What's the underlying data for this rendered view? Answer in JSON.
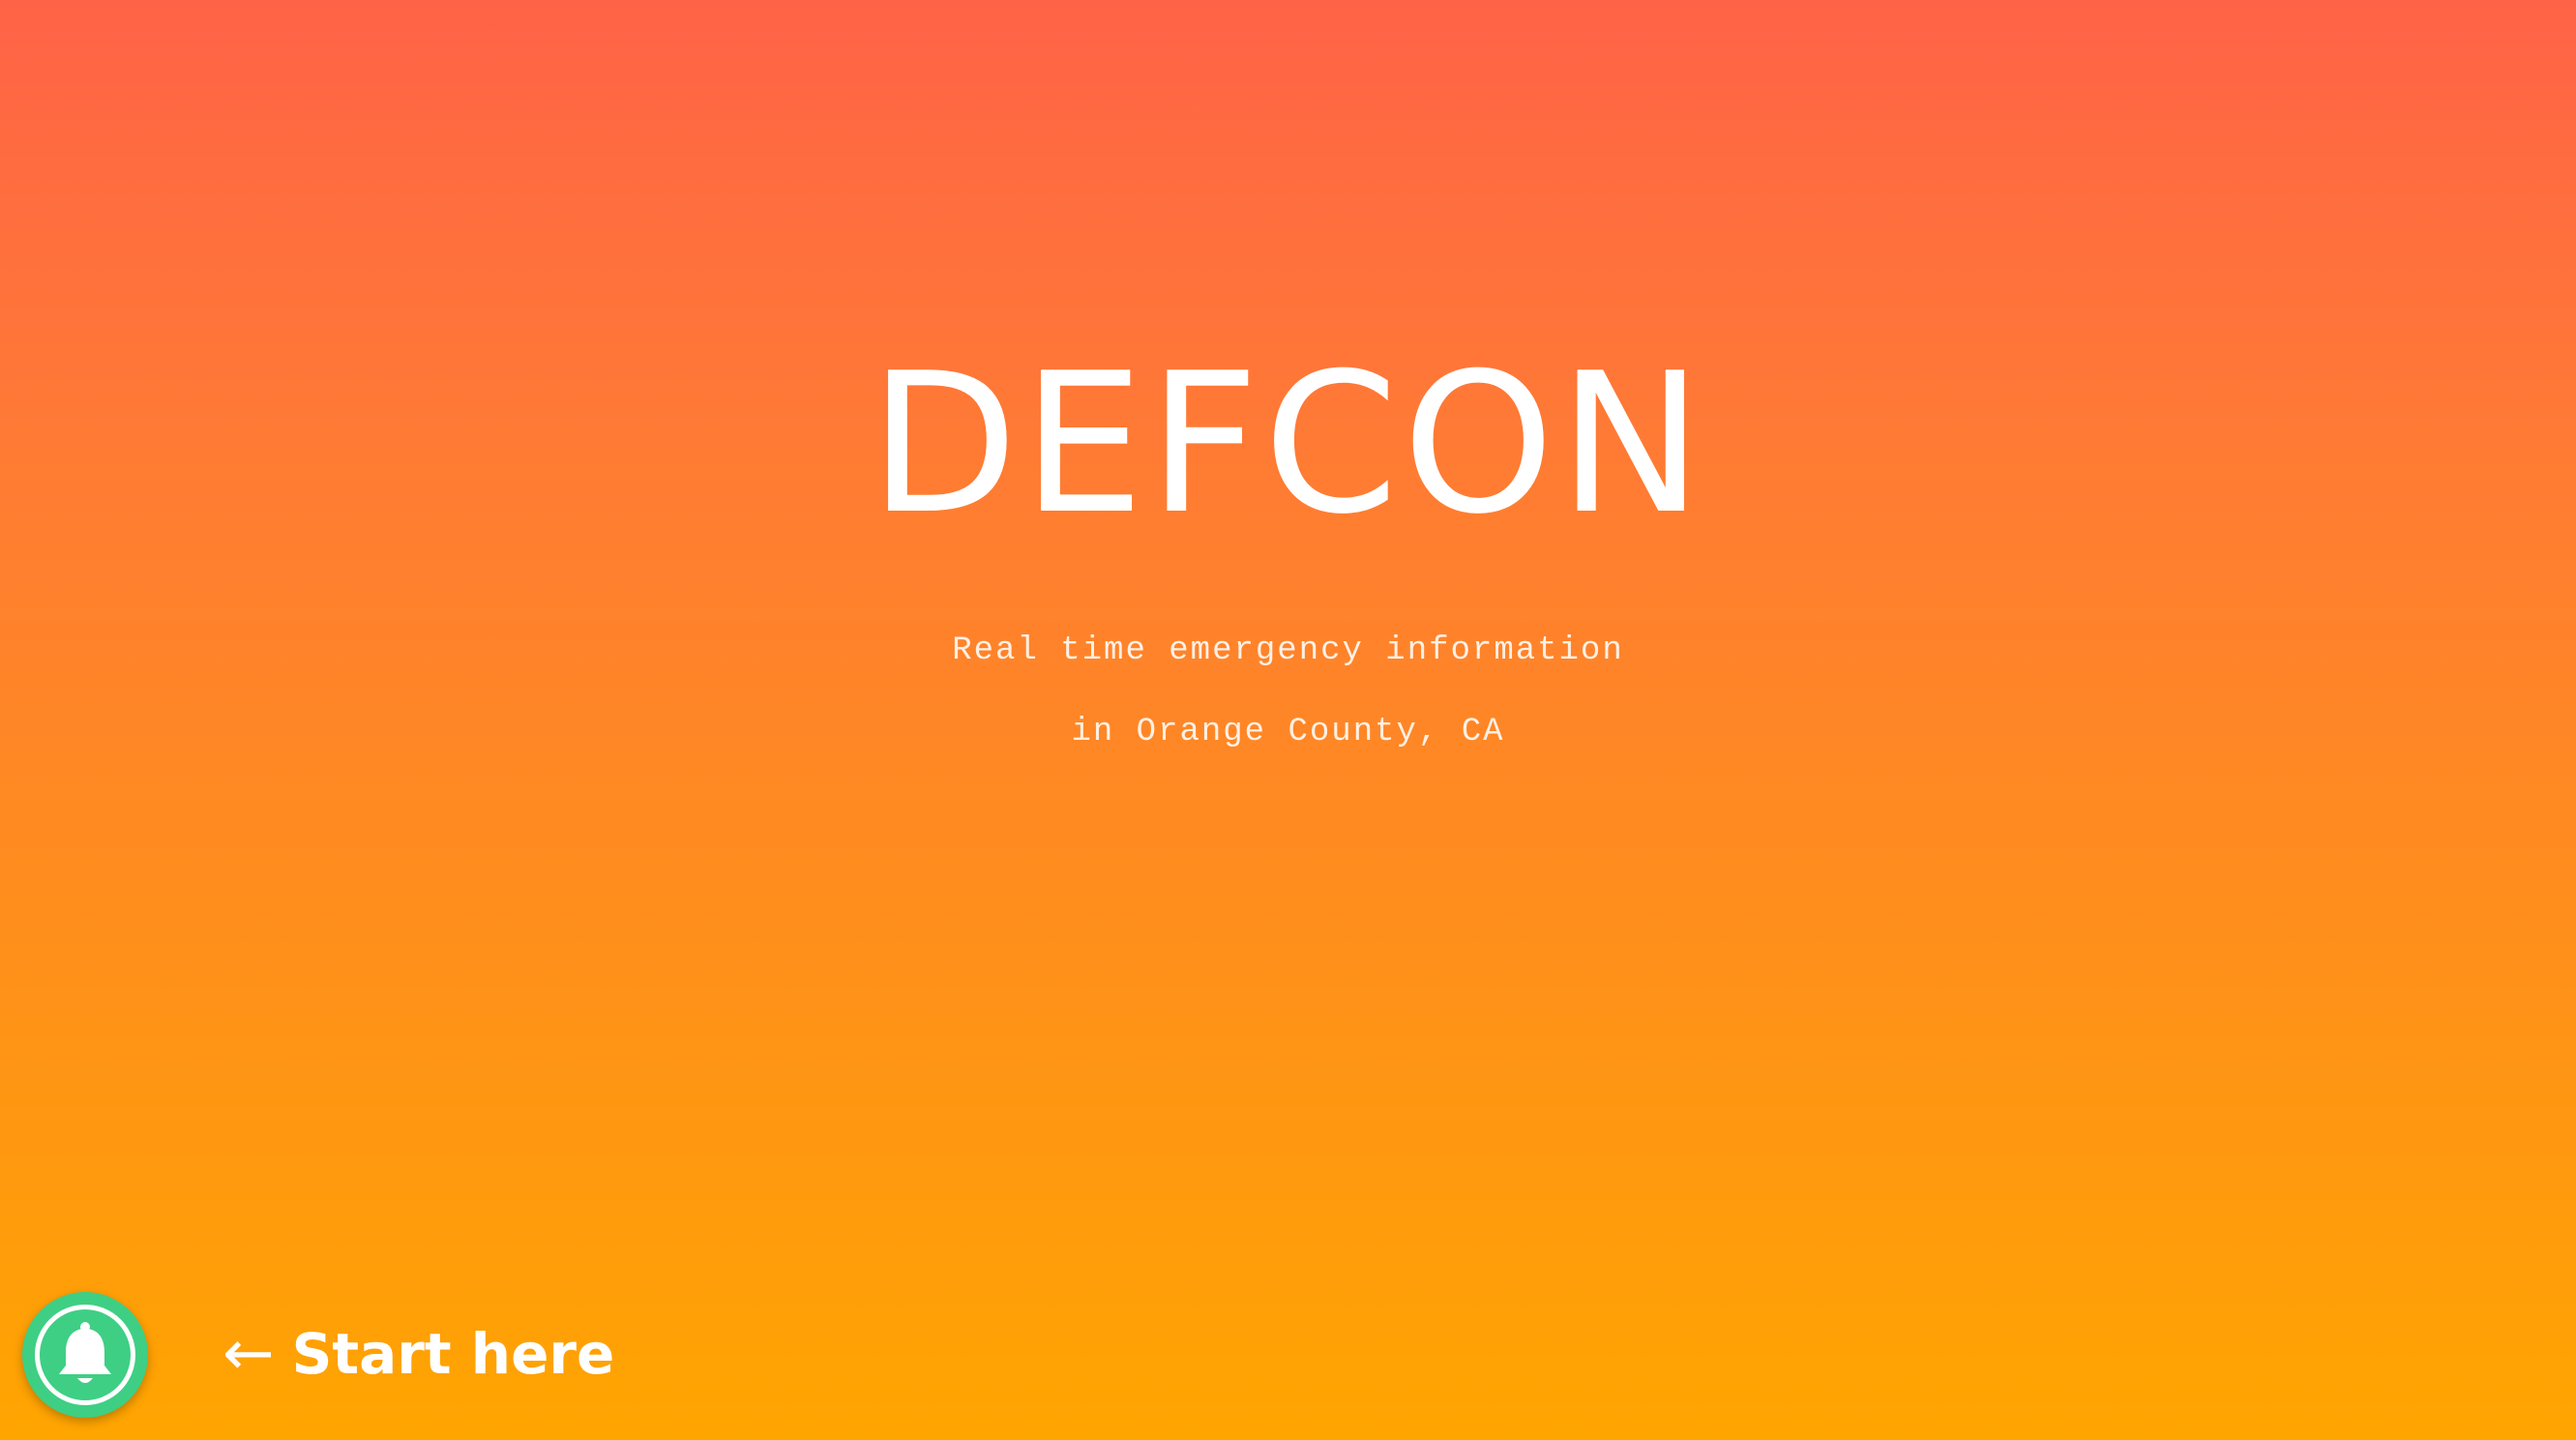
{
  "hero": {
    "title": "DEFCON",
    "subtitle_line1": "Real time emergency information",
    "subtitle_line2": "in Orange County, CA"
  },
  "notify": {
    "icon": "bell-icon",
    "button_color": "#3ecf84"
  },
  "cta": {
    "arrow": "←",
    "label": "Start here"
  },
  "colors": {
    "gradient_top": "#ff6347",
    "gradient_bottom": "#ffa500",
    "text": "#ffffff"
  }
}
